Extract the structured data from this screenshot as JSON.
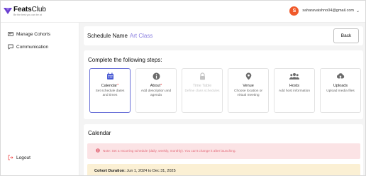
{
  "brand": {
    "name_bold": "Feats",
    "name_light": "Club",
    "tagline": "Be the best you can be at"
  },
  "user": {
    "initial": "S",
    "email": "saharavaishno04@gmail.com"
  },
  "sidebar": {
    "items": [
      {
        "label": "Manage Cohorts",
        "icon": "users-icon"
      },
      {
        "label": "Communication",
        "icon": "chat-icon"
      }
    ],
    "logout_label": "Logout"
  },
  "schedule": {
    "label": "Schedule Name",
    "value": "Art Class",
    "back_label": "Back"
  },
  "steps": {
    "title": "Complete the following steps:",
    "items": [
      {
        "title": "Calendar",
        "required": "*",
        "desc": "Set schedule dates and times",
        "icon": "calendar-icon",
        "state": "active"
      },
      {
        "title": "About",
        "required": "*",
        "desc": "Add description and agenda",
        "icon": "info-icon",
        "state": "normal"
      },
      {
        "title": "Time Table",
        "required": "",
        "desc": "Define class schedules",
        "icon": "lock-icon",
        "state": "disabled"
      },
      {
        "title": "Venue",
        "required": "",
        "desc": "Choose location or virtual meeting",
        "icon": "location-icon",
        "state": "normal"
      },
      {
        "title": "Hosts",
        "required": "",
        "desc": "Add host information",
        "icon": "hosts-icon",
        "state": "normal"
      },
      {
        "title": "Uploads",
        "required": "",
        "desc": "Upload media files",
        "icon": "upload-icon",
        "state": "normal"
      }
    ]
  },
  "calendar": {
    "title": "Calendar",
    "note": "Note: Set a recurring schedule (daily, weekly, monthly). You can't change it after launching.",
    "duration_label": "Cohort Duration:",
    "duration_value": "Jun 1, 2024 to Dec 31, 2025"
  },
  "colors": {
    "accent": "#6b72d8",
    "brand": "#6a3fd0",
    "avatar": "#f0592a",
    "note_bg": "#fbe3e5",
    "note_text": "#e36b7a",
    "duration_bg": "#fbf0d4"
  }
}
